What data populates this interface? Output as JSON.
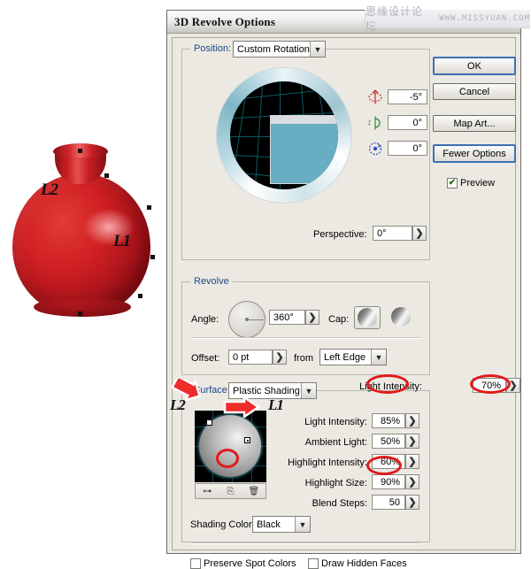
{
  "window": {
    "title": "3D Revolve Options",
    "watermark_cn": "思缘设计论坛",
    "watermark_en": "WWW.MISSYUAN.COM"
  },
  "illustration": {
    "label_l1": "L1",
    "label_l2": "L2",
    "object_color": "#cf1f22"
  },
  "position": {
    "group_title": "Position:",
    "preset": "Custom Rotation",
    "rotate_x_icon": "rotate-x-axis-icon",
    "rotate_y_icon": "rotate-y-axis-icon",
    "rotate_z_icon": "rotate-z-axis-icon",
    "rotate_x": "-5°",
    "rotate_y": "0°",
    "rotate_z": "0°",
    "perspective_label": "Perspective:",
    "perspective": "0°",
    "spinner_glyph": "❯"
  },
  "revolve": {
    "group_title": "Revolve",
    "angle_label": "Angle:",
    "angle": "360°",
    "cap_label": "Cap:",
    "cap_on_icon": "cap-on-icon",
    "cap_off_icon": "cap-off-icon",
    "offset_label": "Offset:",
    "offset": "0 pt",
    "from_label": "from",
    "from_value": "Left Edge"
  },
  "surface": {
    "group_title": "Surface:",
    "shading": "Plastic Shading",
    "light_label_left": "Light Intensity:",
    "light_value_left": "85%",
    "light_label_right": "Light Intensity:",
    "light_value_right": "70%",
    "ambient_label": "Ambient Light:",
    "ambient_value": "50%",
    "highlight_intensity_label": "Highlight Intensity:",
    "highlight_intensity_value": "60%",
    "highlight_size_label": "Highlight Size:",
    "highlight_size_value": "90%",
    "blend_steps_label": "Blend Steps:",
    "blend_steps_value": "50",
    "shading_color_label": "Shading Color:",
    "shading_color_value": "Black",
    "preserve_spot_colors": "Preserve Spot Colors",
    "draw_hidden_faces": "Draw Hidden Faces",
    "tool_move_icon": "move-light-to-back-icon",
    "tool_new_icon": "new-light-icon",
    "tool_delete_icon": "delete-light-icon",
    "light_label_l1": "L1",
    "light_label_l2": "L2"
  },
  "buttons": {
    "ok": "OK",
    "cancel": "Cancel",
    "map_art": "Map Art...",
    "fewer_options": "Fewer Options",
    "preview": "Preview",
    "preview_checked": "✔",
    "checkbox_unchecked": ""
  },
  "annotation": {
    "highlight_color": "#e01b1b"
  }
}
